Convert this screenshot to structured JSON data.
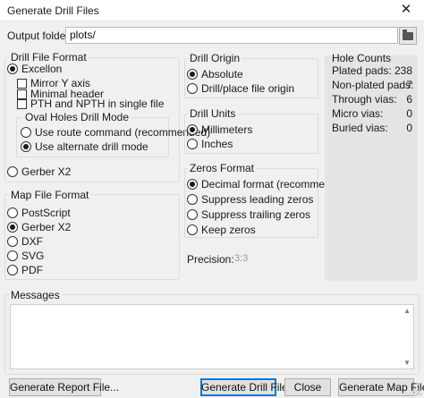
{
  "window": {
    "title": "Generate Drill Files"
  },
  "output": {
    "label": "Output folder:",
    "value": "plots/"
  },
  "drill_file_format": {
    "title": "Drill File Format",
    "excellon": {
      "label": "Excellon",
      "selected": true
    },
    "mirror_y": {
      "label": "Mirror Y axis",
      "checked": false
    },
    "minimal_header": {
      "label": "Minimal header",
      "checked": false
    },
    "pth_npth": {
      "label": "PTH and NPTH in single file",
      "checked": false
    },
    "oval_holes": {
      "title": "Oval Holes Drill Mode",
      "route": {
        "label": "Use route command (recommended)",
        "selected": false
      },
      "alternate": {
        "label": "Use alternate drill mode",
        "selected": true
      }
    },
    "gerber_x2": {
      "label": "Gerber X2",
      "selected": false
    }
  },
  "map_file_format": {
    "title": "Map File Format",
    "options": [
      {
        "label": "PostScript",
        "selected": false
      },
      {
        "label": "Gerber X2",
        "selected": true
      },
      {
        "label": "DXF",
        "selected": false
      },
      {
        "label": "SVG",
        "selected": false
      },
      {
        "label": "PDF",
        "selected": false
      }
    ]
  },
  "drill_origin": {
    "title": "Drill Origin",
    "options": [
      {
        "label": "Absolute",
        "selected": true
      },
      {
        "label": "Drill/place file origin",
        "selected": false
      }
    ]
  },
  "drill_units": {
    "title": "Drill Units",
    "options": [
      {
        "label": "Millimeters",
        "selected": true
      },
      {
        "label": "Inches",
        "selected": false
      }
    ]
  },
  "zeros_format": {
    "title": "Zeros Format",
    "options": [
      {
        "label": "Decimal format (recommended)",
        "selected": true
      },
      {
        "label": "Suppress leading zeros",
        "selected": false
      },
      {
        "label": "Suppress trailing zeros",
        "selected": false
      },
      {
        "label": "Keep zeros",
        "selected": false
      }
    ]
  },
  "precision": {
    "label": "Precision:",
    "value": "3:3"
  },
  "hole_counts": {
    "title": "Hole Counts",
    "rows": [
      {
        "label": "Plated pads:",
        "value": "238"
      },
      {
        "label": "Non-plated pads:",
        "value": "7"
      },
      {
        "label": "Through vias:",
        "value": "6"
      },
      {
        "label": "Micro vias:",
        "value": "0"
      },
      {
        "label": "Buried vias:",
        "value": "0"
      }
    ]
  },
  "messages": {
    "title": "Messages"
  },
  "buttons": {
    "report": "Generate Report File...",
    "drill": "Generate Drill File",
    "close": "Close",
    "map": "Generate Map File"
  },
  "icons": {
    "close": "close-icon",
    "folder": "folder-icon"
  }
}
